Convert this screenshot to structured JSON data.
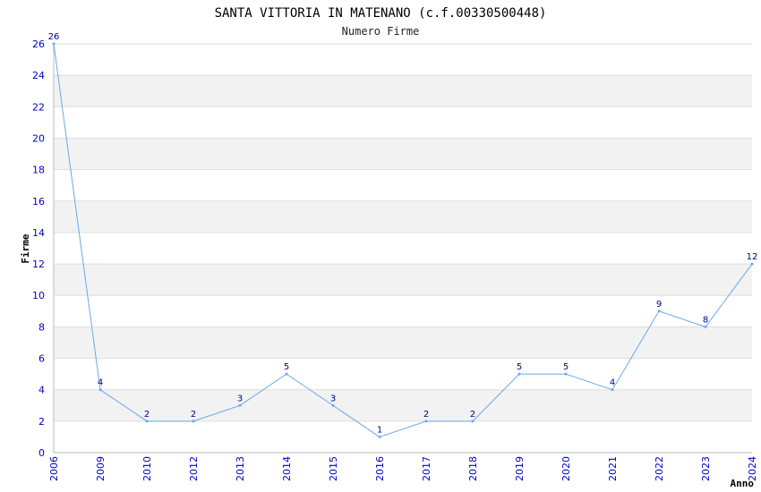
{
  "colors": {
    "band": "#f2f2f2",
    "grid": "#dddddd",
    "axis": "#bbbbbb",
    "line": "#66aaee",
    "tick": "#0000cc",
    "data_label": "#000080"
  },
  "chart_data": {
    "type": "line",
    "title": "SANTA VITTORIA IN MATENANO (c.f.00330500448)",
    "subtitle": "Numero Firme",
    "xlabel": "Anno",
    "ylabel": "Firme",
    "categories": [
      "2006",
      "2009",
      "2010",
      "2012",
      "2013",
      "2014",
      "2015",
      "2016",
      "2017",
      "2018",
      "2019",
      "2020",
      "2021",
      "2022",
      "2023",
      "2024"
    ],
    "series": [
      {
        "values": [
          26,
          4,
          2,
          2,
          3,
          5,
          3,
          1,
          2,
          2,
          5,
          5,
          4,
          9,
          8,
          12
        ]
      }
    ],
    "ylim": [
      0,
      26
    ],
    "yticks": [
      0,
      2,
      4,
      6,
      8,
      10,
      12,
      14,
      16,
      18,
      20,
      22,
      24,
      26
    ],
    "grid": true,
    "legend": "none"
  }
}
